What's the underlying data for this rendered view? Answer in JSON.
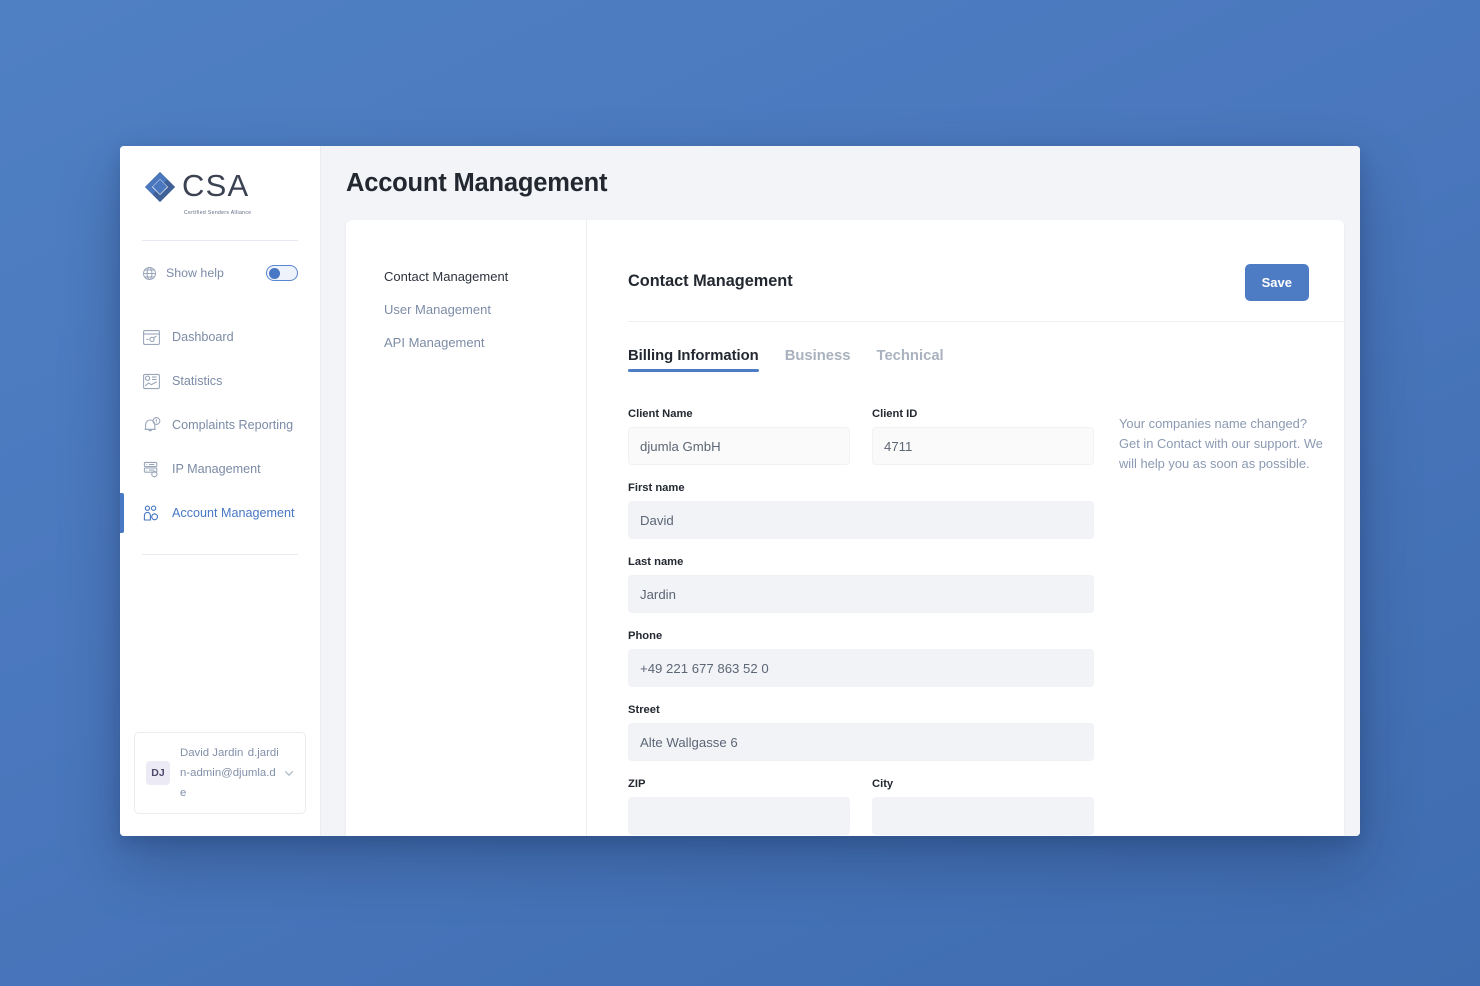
{
  "theme": {
    "background": "#4a77bd",
    "accent": "#4e7cc4",
    "muted_text": "#7c8ba6",
    "dark_text": "#222730",
    "card_bg": "#ffffff",
    "content_bg": "#f2f4f8",
    "input_bg": "#f1f3f7",
    "input_readonly_bg": "#fafafa"
  },
  "sidebar": {
    "logo": {
      "word": "CSA",
      "tagline": "Certified Senders Alliance",
      "mark_icon": "diamond-logo-icon"
    },
    "show_help": {
      "icon": "globe-help-icon",
      "label": "Show help",
      "toggle_state": "off"
    },
    "items": [
      {
        "label": "Dashboard",
        "icon": "dashboard-icon",
        "active": false
      },
      {
        "label": "Statistics",
        "icon": "statistics-icon",
        "active": false
      },
      {
        "label": "Complaints Reporting",
        "icon": "complaints-bell-icon",
        "active": false
      },
      {
        "label": "IP Management",
        "icon": "ip-server-icon",
        "active": false
      },
      {
        "label": "Account Management",
        "icon": "account-users-icon",
        "active": true
      }
    ],
    "user": {
      "initials": "DJ",
      "name": "David Jardin",
      "email": "d.jardin-admin@djumla.de",
      "chevron_icon": "chevron-down-icon"
    }
  },
  "header": {
    "title": "Account Management"
  },
  "subnav": {
    "items": [
      {
        "label": "Contact Management",
        "active": true
      },
      {
        "label": "User Management",
        "active": false
      },
      {
        "label": "API Management",
        "active": false
      }
    ]
  },
  "panel": {
    "title": "Contact Management",
    "save_label": "Save",
    "tabs": [
      {
        "label": "Billing Information",
        "active": true
      },
      {
        "label": "Business",
        "active": false
      },
      {
        "label": "Technical",
        "active": false
      }
    ],
    "help_text": "Your companies name changed? Get in Contact with our support. We will help you as soon as possible.",
    "fields": {
      "client_name": {
        "label": "Client Name",
        "value": "djumla GmbH",
        "readonly": true
      },
      "client_id": {
        "label": "Client ID",
        "value": "4711",
        "readonly": true
      },
      "first_name": {
        "label": "First name",
        "value": "David",
        "readonly": false
      },
      "last_name": {
        "label": "Last name",
        "value": "Jardin",
        "readonly": false
      },
      "phone": {
        "label": "Phone",
        "value": "+49 221 677 863 52 0",
        "readonly": false
      },
      "street": {
        "label": "Street",
        "value": "Alte Wallgasse 6",
        "readonly": false
      },
      "zip": {
        "label": "ZIP",
        "value": "",
        "readonly": false
      },
      "city": {
        "label": "City",
        "value": "",
        "readonly": false
      }
    }
  }
}
